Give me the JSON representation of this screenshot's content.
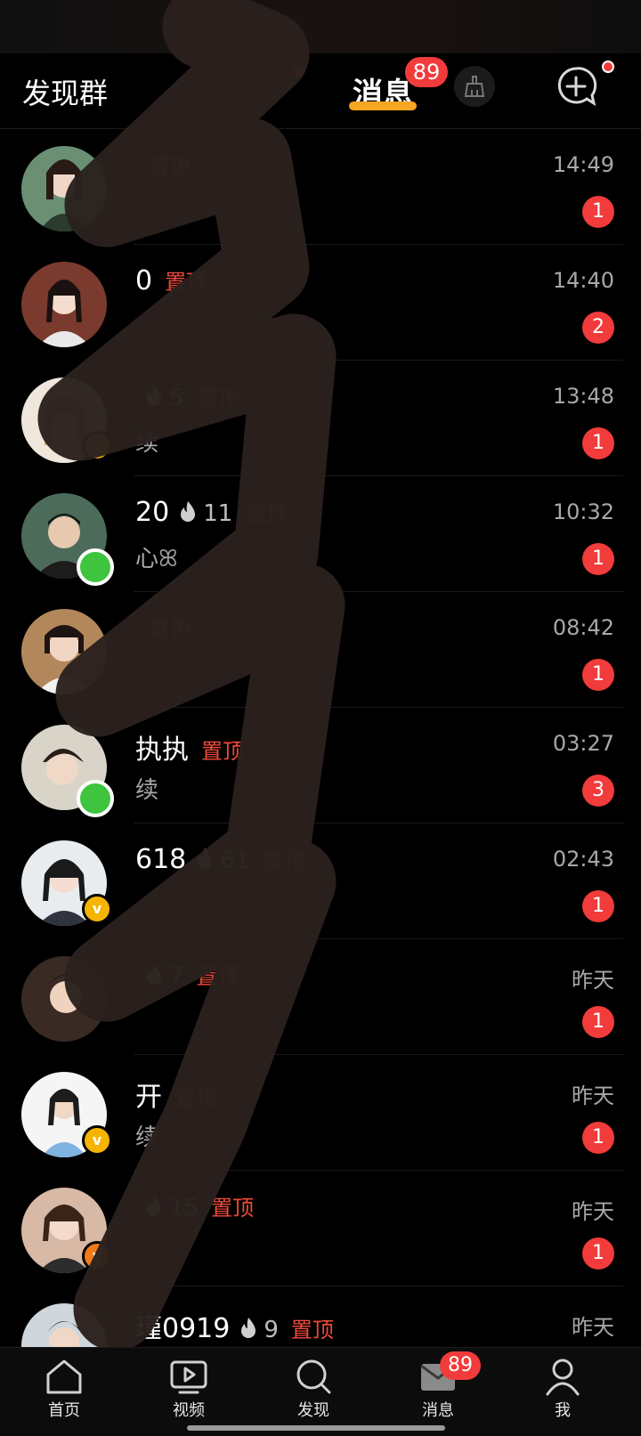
{
  "top_nav": {
    "left_link": "发现群",
    "other_tab": "",
    "active_tab": "消息",
    "active_badge": "89"
  },
  "conversations": [
    {
      "name": "",
      "pin_label": "置顶",
      "time": "14:49",
      "unread": "1",
      "preview": ""
    },
    {
      "name": "0",
      "pin_label": "置顶",
      "time": "14:40",
      "unread": "2",
      "preview": ""
    },
    {
      "name": "",
      "fire_count": "5",
      "pin_label": "置顶",
      "time": "13:48",
      "unread": "1",
      "preview": "续"
    },
    {
      "name": "20",
      "fire_count": "11",
      "pin_label": "置顶",
      "time": "10:32",
      "unread": "1",
      "preview": "心ꕤ"
    },
    {
      "name": "",
      "pin_label": "置顶",
      "time": "08:42",
      "unread": "1",
      "preview": ""
    },
    {
      "name": "执执",
      "pin_label": "置顶",
      "time": "03:27",
      "unread": "3",
      "preview": "续"
    },
    {
      "name": "618",
      "fire_count": "61",
      "pin_label": "置顶",
      "time": "02:43",
      "unread": "1",
      "preview": ""
    },
    {
      "name": "",
      "fire_count": "7",
      "pin_label": "置顶",
      "time": "昨天",
      "unread": "1",
      "preview": ""
    },
    {
      "name": "开",
      "pin_label": "置顶",
      "time": "昨天",
      "unread": "1",
      "preview": "续"
    },
    {
      "name": "",
      "fire_count": "15",
      "pin_label": "置顶",
      "time": "昨天",
      "unread": "1",
      "preview": ""
    },
    {
      "name": "瑾0919",
      "fire_count": "9",
      "pin_label": "置顶",
      "time": "昨天",
      "unread": "",
      "preview": ""
    }
  ],
  "tabbar": {
    "items": [
      {
        "label": "首页",
        "icon": "home-icon"
      },
      {
        "label": "视频",
        "icon": "video-icon"
      },
      {
        "label": "发现",
        "icon": "search-icon"
      },
      {
        "label": "消息",
        "icon": "message-icon",
        "badge": "89"
      },
      {
        "label": "我",
        "icon": "profile-icon"
      }
    ]
  },
  "colors": {
    "accent_red": "#f23b3b",
    "pin_red": "#f04a3a",
    "tab_underline": "#f5a623",
    "online_green": "#3ec43e",
    "verified_gold": "#f5b400"
  }
}
